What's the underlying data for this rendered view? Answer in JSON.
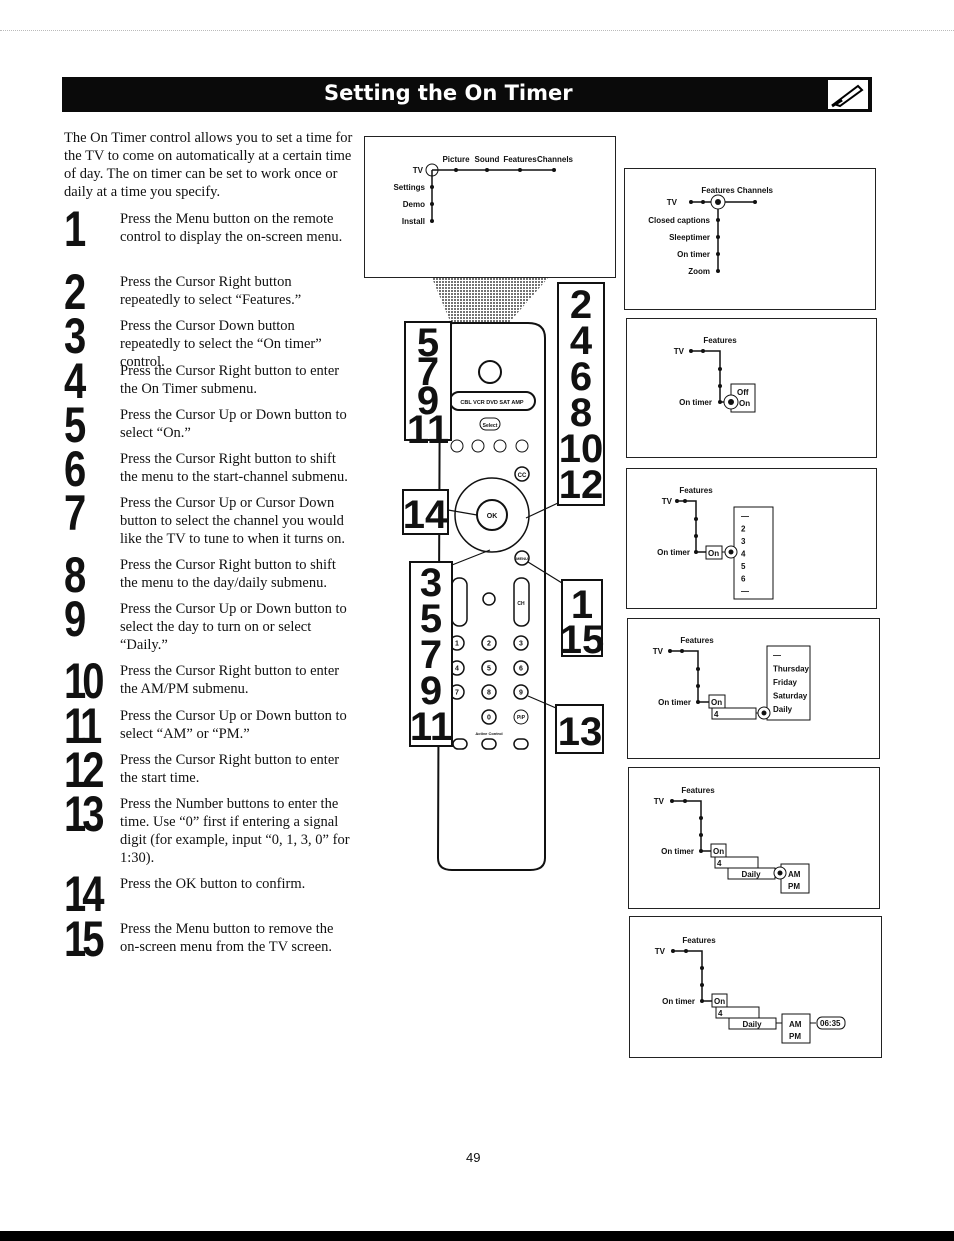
{
  "header": {
    "title": "Setting the On Timer",
    "icon": "writing-hand-icon"
  },
  "intro": "The On Timer control allows you to set a time for the TV to come on automatically at a certain time of day. The on timer can be set to work once or daily at a time you specify.",
  "steps": [
    {
      "n": "1",
      "text": "Press the Menu button on the remote control to display the on-screen menu."
    },
    {
      "n": "2",
      "text": "Press the Cursor Right button repeatedly to select “Features.”"
    },
    {
      "n": "3",
      "text": "Press the Cursor Down button repeatedly to select the “On timer” control."
    },
    {
      "n": "4",
      "text": "Press the Cursor Right button to enter the On Timer submenu."
    },
    {
      "n": "5",
      "text": "Press the Cursor Up or Down button to select “On.”"
    },
    {
      "n": "6",
      "text": "Press the Cursor Right button to shift the menu to the start-channel submenu."
    },
    {
      "n": "7",
      "text": "Press the Cursor Up or Cursor Down button to select the channel you would like the TV to tune to when it turns on."
    },
    {
      "n": "8",
      "text": "Press the Cursor Right button to shift the menu to the day/daily submenu."
    },
    {
      "n": "9",
      "text": "Press the Cursor Up or Down button to select the day to turn on or select “Daily.”"
    },
    {
      "n": "10",
      "text": "Press the Cursor Right button to enter the AM/PM submenu."
    },
    {
      "n": "11",
      "text": "Press the Cursor Up or Down button to select “AM” or “PM.”"
    },
    {
      "n": "12",
      "text": "Press the Cursor Right button to enter the start time."
    },
    {
      "n": "13",
      "text": "Press the Number buttons to enter the time. Use “0” first if entering a signal digit (for example, input “0, 1, 3, 0” for 1:30)."
    },
    {
      "n": "14",
      "text": "Press the OK button to confirm."
    },
    {
      "n": "15",
      "text": "Press the Menu button to remove the on-screen menu from the TV screen."
    }
  ],
  "menu_main": {
    "tv": "TV",
    "top": [
      "Picture",
      "Sound",
      "Features",
      "Channels"
    ],
    "side": [
      "Settings",
      "Demo",
      "Install"
    ]
  },
  "menu_features": {
    "tv": "TV",
    "top": [
      "Features",
      "Channels"
    ],
    "side": [
      "Closed captions",
      "Sleeptimer",
      "On timer",
      "Zoom"
    ]
  },
  "diagrams": {
    "tv": "TV",
    "features": "Features",
    "on_timer": "On timer",
    "off": "Off",
    "on": "On",
    "channels": [
      "—",
      "2",
      "3",
      "4",
      "5",
      "6",
      "—"
    ],
    "channel": "4",
    "days": [
      "—",
      "Thursday",
      "Friday",
      "Saturday",
      "Daily"
    ],
    "daily": "Daily",
    "am": "AM",
    "pm": "PM",
    "time": "06:35"
  },
  "remote": {
    "callouts_left_top": [
      "5",
      "7",
      "9",
      "11"
    ],
    "callout_ok": "14",
    "callouts_left_bottom": [
      "3",
      "5",
      "7",
      "9",
      "11"
    ],
    "callouts_right_top": [
      "2",
      "4",
      "6",
      "8",
      "10",
      "12"
    ],
    "callouts_menu": [
      "1",
      "15"
    ],
    "callout_digits": "13",
    "sources": "CBL VCR DVD SAT AMP",
    "select": "Select",
    "cc": "CC",
    "ok": "OK",
    "menu": "MENU",
    "ch": "CH",
    "digits": [
      "1",
      "2",
      "3",
      "4",
      "5",
      "6",
      "7",
      "8",
      "9",
      "0"
    ],
    "pip": "PiP",
    "active_control": "Active Control"
  },
  "page_number": "49"
}
